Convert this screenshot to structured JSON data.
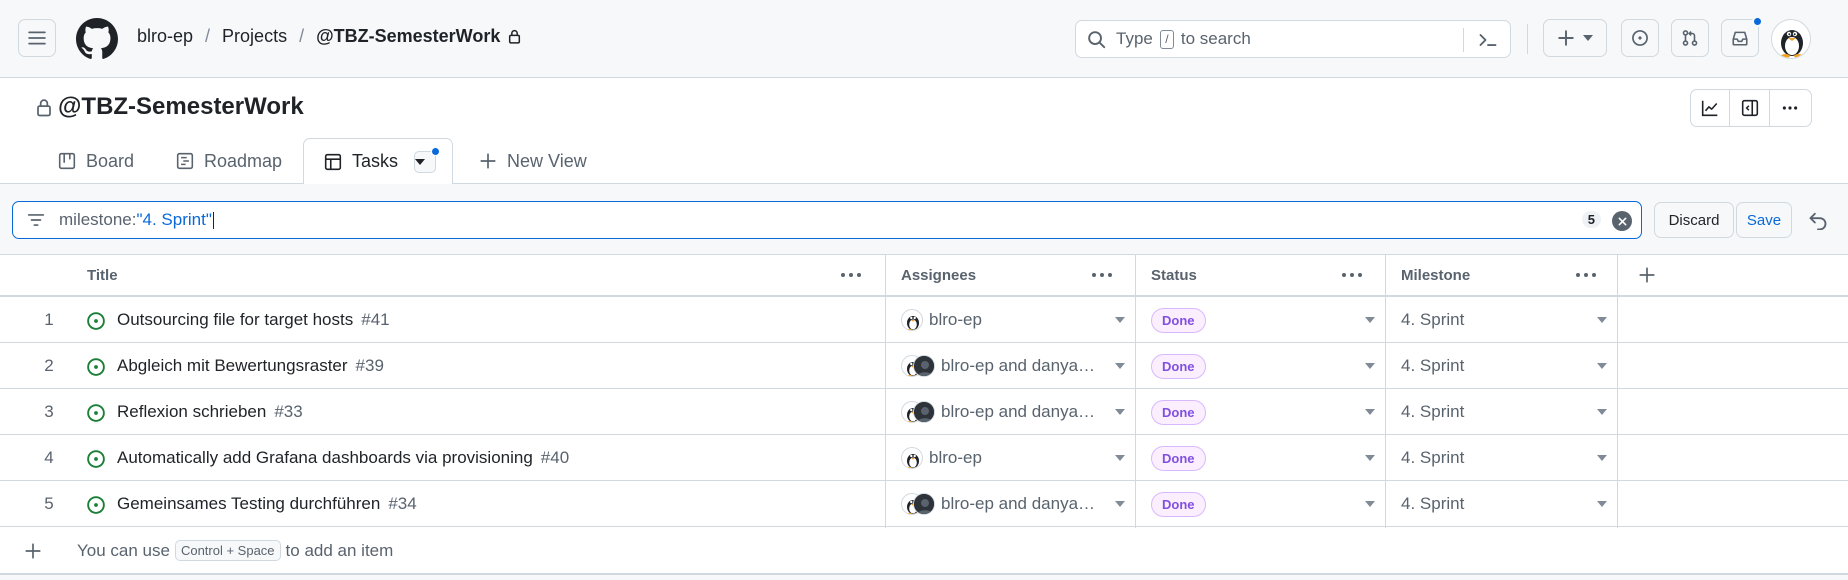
{
  "header": {
    "breadcrumbs": [
      "blro-ep",
      "Projects",
      "@TBZ-SemesterWork"
    ],
    "search_prefix": "Type",
    "search_key": "/",
    "search_suffix": "to search"
  },
  "project": {
    "title": "@TBZ-SemesterWork"
  },
  "tabs": [
    {
      "label": "Board",
      "icon": "board-icon"
    },
    {
      "label": "Roadmap",
      "icon": "roadmap-icon"
    },
    {
      "label": "Tasks",
      "icon": "table-icon",
      "active": true
    },
    {
      "label": "New View",
      "icon": "plus-icon"
    }
  ],
  "filter": {
    "key": "milestone:",
    "value": "\"4. Sprint\"",
    "count": "5",
    "discard_label": "Discard",
    "save_label": "Save"
  },
  "table": {
    "columns": [
      "Title",
      "Assignees",
      "Status",
      "Milestone"
    ],
    "rows": [
      {
        "n": "1",
        "title": "Outsourcing file for target hosts",
        "number": "#41",
        "assignees": "blro-ep",
        "two_avatars": false,
        "status": "Done",
        "milestone": "4. Sprint"
      },
      {
        "n": "2",
        "title": "Abgleich mit Bewertungsraster",
        "number": "#39",
        "assignees": "blro-ep and danya…",
        "two_avatars": true,
        "status": "Done",
        "milestone": "4. Sprint"
      },
      {
        "n": "3",
        "title": "Reflexion schrieben",
        "number": "#33",
        "assignees": "blro-ep and danya…",
        "two_avatars": true,
        "status": "Done",
        "milestone": "4. Sprint"
      },
      {
        "n": "4",
        "title": "Automatically add Grafana dashboards via provisioning",
        "number": "#40",
        "assignees": "blro-ep",
        "two_avatars": false,
        "status": "Done",
        "milestone": "4. Sprint"
      },
      {
        "n": "5",
        "title": "Gemeinsames Testing durchführen",
        "number": "#34",
        "assignees": "blro-ep and danya…",
        "two_avatars": true,
        "status": "Done",
        "milestone": "4. Sprint"
      }
    ],
    "add_hint_prefix": "You can use",
    "add_hint_key": "Control + Space",
    "add_hint_suffix": "to add an item"
  },
  "colors": {
    "accent": "#0969da",
    "open_issue": "#1a7f37",
    "done_purple": "#8250df"
  }
}
